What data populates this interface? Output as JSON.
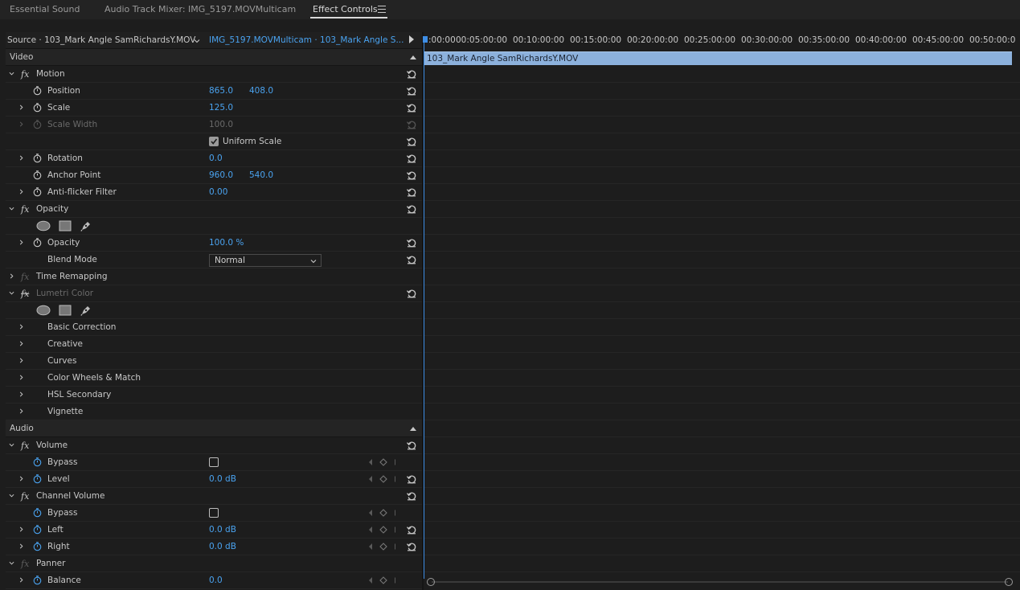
{
  "tabs": [
    {
      "label": "Essential Sound"
    },
    {
      "label": "Audio Track Mixer: IMG_5197.MOVMulticam"
    },
    {
      "label": "Effect Controls"
    }
  ],
  "source_bar": {
    "source": "Source · 103_Mark Angle SamRichardsY.MOV",
    "sequence": "IMG_5197.MOVMulticam · 103_Mark Angle S..."
  },
  "timeline": {
    "ticks": [
      ":00:00",
      "00:05:00:00",
      "00:10:00:00",
      "00:15:00:00",
      "00:20:00:00",
      "00:25:00:00",
      "00:30:00:00",
      "00:35:00:00",
      "00:40:00:00",
      "00:45:00:00",
      "00:50:00:0"
    ],
    "clip_name": "103_Mark Angle SamRichardsY.MOV"
  },
  "video_section": "Video",
  "audio_section": "Audio",
  "motion": {
    "name": "Motion",
    "position": {
      "label": "Position",
      "x": "865.0",
      "y": "408.0"
    },
    "scale": {
      "label": "Scale",
      "value": "125.0"
    },
    "scale_width": {
      "label": "Scale Width",
      "value": "100.0"
    },
    "uniform_scale": {
      "label": "Uniform Scale",
      "checked": true
    },
    "rotation": {
      "label": "Rotation",
      "value": "0.0"
    },
    "anchor_point": {
      "label": "Anchor Point",
      "x": "960.0",
      "y": "540.0"
    },
    "anti_flicker": {
      "label": "Anti-flicker Filter",
      "value": "0.00"
    }
  },
  "opacity": {
    "name": "Opacity",
    "opacity": {
      "label": "Opacity",
      "value": "100.0 %"
    },
    "blend_mode": {
      "label": "Blend Mode",
      "value": "Normal"
    }
  },
  "time_remapping": {
    "name": "Time Remapping"
  },
  "lumetri": {
    "name": "Lumetri Color",
    "groups": [
      "Basic Correction",
      "Creative",
      "Curves",
      "Color Wheels & Match",
      "HSL Secondary",
      "Vignette"
    ]
  },
  "volume": {
    "name": "Volume",
    "bypass": {
      "label": "Bypass"
    },
    "level": {
      "label": "Level",
      "value": "0.0 dB"
    }
  },
  "channel_volume": {
    "name": "Channel Volume",
    "bypass": {
      "label": "Bypass"
    },
    "left": {
      "label": "Left",
      "value": "0.0 dB"
    },
    "right": {
      "label": "Right",
      "value": "0.0 dB"
    }
  },
  "panner": {
    "name": "Panner",
    "balance": {
      "label": "Balance",
      "value": "0.0"
    }
  },
  "colors": {
    "value_blue": "#4aa3f0",
    "clip_blue": "#8cb1dc",
    "playhead_blue": "#3e8ee6",
    "background": "#1d1d1d"
  }
}
